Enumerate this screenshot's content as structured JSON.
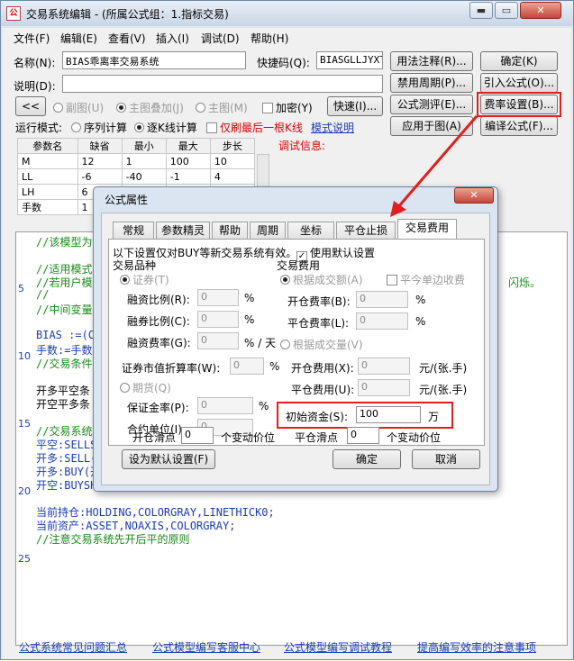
{
  "window": {
    "app_icon": "formula-icon",
    "title": "交易系统编辑 - (所属公式组：1.指标交易)",
    "controls": {
      "minimize": "▬",
      "maximize": "▭",
      "close": "✕"
    }
  },
  "menu": [
    "文件(F)",
    "编辑(E)",
    "查看(V)",
    "插入(I)",
    "调试(D)",
    "帮助(H)"
  ],
  "form": {
    "name_label": "名称(N):",
    "name_value": "BIAS乖离率交易系统",
    "shortcut_label": "快捷码(Q):",
    "shortcut_value": "BIASGLLJYXT",
    "desc_label": "说明(D):",
    "desc_value": "",
    "collapse_btn": "<<",
    "radio_sub": "副图(U)",
    "radio_main_overlay": "主图叠加(J)",
    "radio_main": "主图(M)",
    "encrypt": "加密(Y)",
    "fast_btn": "快速(I)...",
    "run_mode_label": "运行模式:",
    "run_seq": "序列计算",
    "run_tick": "逐K线计算",
    "only_last": "仅刷最后一根K线",
    "mode_link": "模式说明",
    "debug_label": "调试信息:"
  },
  "buttons": {
    "usage_note": "用法注释(R)...",
    "disable_period": "禁用周期(P)...",
    "formula_eval": "公式测评(E)...",
    "apply_chart": "应用于图(A)",
    "ok": "确定(K)",
    "import": "引入公式(O)...",
    "fee_settings": "费率设置(B)...",
    "compile": "编译公式(F)..."
  },
  "params": {
    "headers": [
      "参数名",
      "缺省",
      "最小",
      "最大",
      "步长"
    ],
    "rows": [
      [
        "M",
        "12",
        "1",
        "100",
        "10"
      ],
      [
        "LL",
        "-6",
        "-40",
        "-1",
        "4"
      ],
      [
        "LH",
        "6",
        "",
        "",
        ""
      ],
      [
        "手数",
        "1",
        "",
        "",
        ""
      ]
    ]
  },
  "code_lines": [
    {
      "ln": "",
      "text": "//该模型为"
    },
    {
      "ln": "",
      "text": ""
    },
    {
      "ln": "",
      "text": "//适用模式"
    },
    {
      "ln": "",
      "text": "//若用户模"
    },
    {
      "ln": "5",
      "text": "//"
    },
    {
      "ln": "",
      "text": "//中间变量"
    },
    {
      "ln": "",
      "text": ""
    },
    {
      "ln": "",
      "text": "BIAS :=(CL"
    },
    {
      "ln": "",
      "text": "手数:=手数"
    },
    {
      "ln": "10",
      "text": "//交易条件"
    },
    {
      "ln": "",
      "text": ""
    },
    {
      "ln": "",
      "text": "开多平空条"
    },
    {
      "ln": "",
      "text": "开空平多条"
    },
    {
      "ln": "",
      "text": ""
    },
    {
      "ln": "15",
      "text": "//交易系统"
    },
    {
      "ln": "",
      "text": "平空:SELLS"
    },
    {
      "ln": "",
      "text": "开多:SELL("
    },
    {
      "ln": "",
      "text": "开多:BUY(开"
    },
    {
      "ln": "",
      "text": "开空:BUYSH"
    },
    {
      "ln": "20",
      "text": ""
    },
    {
      "ln": "",
      "text": "当前持仓:HOLDING,COLORGRAY,LINETHICK0;"
    },
    {
      "ln": "",
      "text": "当前资产:ASSET,NOAXIS,COLORGRAY;"
    },
    {
      "ln": "",
      "text": "//注意交易系统先开后平的原则"
    },
    {
      "ln": "",
      "text": ""
    },
    {
      "ln": "25",
      "text": ""
    }
  ],
  "code_hint_right": "闪烁。",
  "bottom_links": [
    "公式系统常见问题汇总",
    "公式模型编写客服中心",
    "公式模型编写调试教程",
    "提高编写效率的注意事项"
  ],
  "dialog": {
    "title": "公式属性",
    "close": "✕",
    "tabs": [
      "常规",
      "参数精灵",
      "帮助",
      "周期",
      "坐标",
      "平仓止损",
      "交易费用"
    ],
    "active_tab": "交易费用",
    "intro": "以下设置仅对BUY等新交易系统有效。",
    "use_default": "使用默认设置",
    "variety_label": "交易品种",
    "stock": "证券(T)",
    "margin_ratio": "融资比例(R):",
    "short_ratio": "融券比例(C):",
    "margin_rate": "融资费率(G):",
    "pct": "%",
    "pct_day": "% / 天",
    "market_ratio": "证券市值折算率(W):",
    "futures": "期货(Q)",
    "deposit": "保证金率(P):",
    "contract_unit": "合约单位(I):",
    "fee_label": "交易费用",
    "by_amount": "根据成交额(A)",
    "no_oneside": "平今单边收费",
    "open_rate": "开仓费率(B):",
    "close_rate": "平仓费率(L):",
    "by_volume": "根据成交量(V)",
    "open_fee": "开仓费用(X):",
    "close_fee": "平仓费用(U):",
    "per_hand": "元/(张.手)",
    "init_capital_label": "初始资金(S):",
    "init_capital_value": "100",
    "wan": "万",
    "open_slip": "开仓滑点",
    "open_slip_value": "0",
    "close_slip": "平仓滑点",
    "close_slip_value": "0",
    "tick_unit": "个变动价位",
    "disabled_value": "0",
    "set_default_btn": "设为默认设置(F)",
    "ok_btn": "确定",
    "cancel_btn": "取消"
  },
  "colors": {
    "highlight": "#e0201c",
    "link": "#1a3cb4",
    "comment": "#1a8a1a"
  }
}
